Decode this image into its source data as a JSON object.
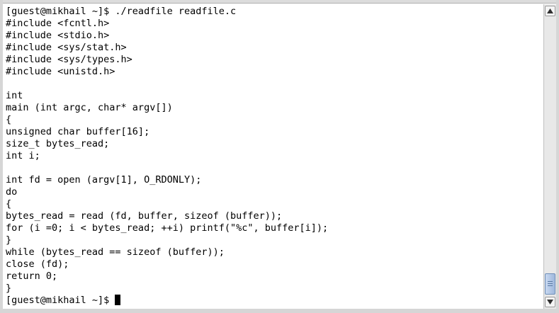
{
  "terminal": {
    "lines": [
      "[guest@mikhail ~]$ ./readfile readfile.c",
      "#include <fcntl.h>",
      "#include <stdio.h>",
      "#include <sys/stat.h>",
      "#include <sys/types.h>",
      "#include <unistd.h>",
      "",
      "int",
      "main (int argc, char* argv[])",
      "{",
      "unsigned char buffer[16];",
      "size_t bytes_read;",
      "int i;",
      "",
      "int fd = open (argv[1], O_RDONLY);",
      "do",
      "{",
      "bytes_read = read (fd, buffer, sizeof (buffer));",
      "for (i =0; i < bytes_read; ++i) printf(\"%c\", buffer[i]);",
      "}",
      "while (bytes_read == sizeof (buffer));",
      "close (fd);",
      "return 0;",
      "}"
    ],
    "prompt": "[guest@mikhail ~]$ "
  },
  "scrollbar": {
    "position_fraction": 1.0
  },
  "icons": {
    "scroll_up": "arrow-up-icon",
    "scroll_down": "arrow-down-icon"
  }
}
